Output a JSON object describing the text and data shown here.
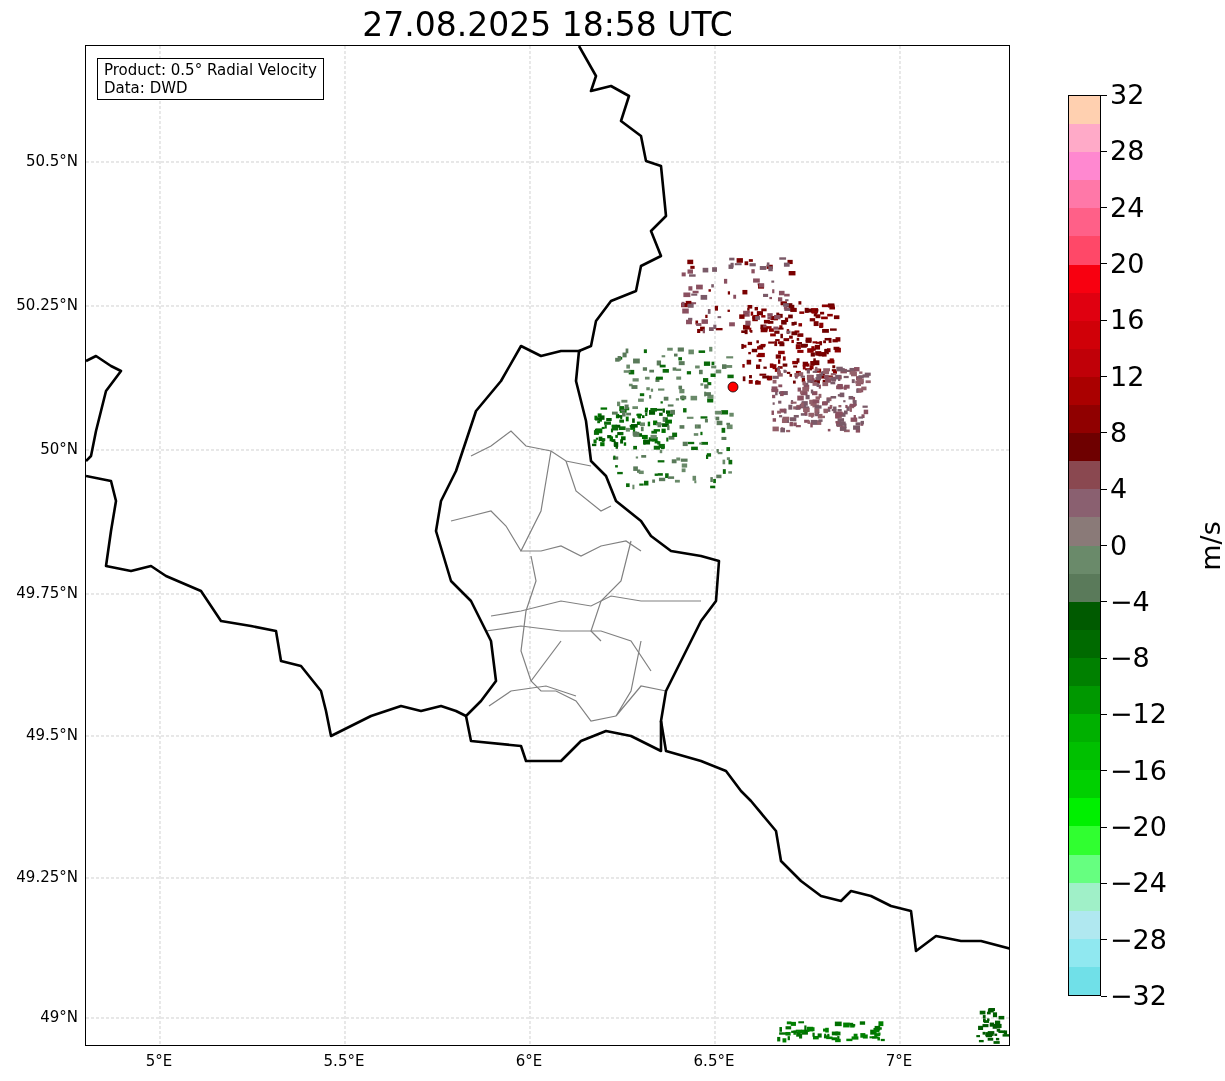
{
  "title": "27.08.2025 18:58 UTC",
  "info_box": {
    "lines": [
      "Product: 0.5° Radial Velocity",
      "Data: DWD"
    ]
  },
  "map": {
    "x_ticks": [
      "5°E",
      "5.5°E",
      "6°E",
      "6.5°E",
      "7°E"
    ],
    "y_ticks": [
      "50.5°N",
      "50.25°N",
      "50°N",
      "49.75°N",
      "49.5°N",
      "49.25°N",
      "49°N"
    ]
  },
  "colorbar": {
    "label": "m/s",
    "ticks": [
      "32",
      "28",
      "24",
      "20",
      "16",
      "12",
      "8",
      "4",
      "0",
      "−4",
      "−8",
      "−12",
      "−16",
      "−20",
      "−24",
      "−28",
      "−32"
    ],
    "segments": [
      {
        "color": "#ffd0b0"
      },
      {
        "color": "#ffaac8"
      },
      {
        "color": "#ff88d0"
      },
      {
        "color": "#ff78a8"
      },
      {
        "color": "#ff6088"
      },
      {
        "color": "#ff4868"
      },
      {
        "color": "#f80010"
      },
      {
        "color": "#e00010"
      },
      {
        "color": "#d00008"
      },
      {
        "color": "#c00008"
      },
      {
        "color": "#aa0000"
      },
      {
        "color": "#900000"
      },
      {
        "color": "#6e0000"
      },
      {
        "color": "#8a4850"
      },
      {
        "color": "#8a6070"
      },
      {
        "color": "#8a7a78"
      },
      {
        "color": "#6a8a6a"
      },
      {
        "color": "#5a7a5a"
      },
      {
        "color": "#005a00"
      },
      {
        "color": "#006a00"
      },
      {
        "color": "#008000"
      },
      {
        "color": "#009800"
      },
      {
        "color": "#00b000"
      },
      {
        "color": "#00c000"
      },
      {
        "color": "#00d000"
      },
      {
        "color": "#00f000"
      },
      {
        "color": "#30ff30"
      },
      {
        "color": "#66ff80"
      },
      {
        "color": "#a0f0c8"
      },
      {
        "color": "#b0e8f0"
      },
      {
        "color": "#90e8f0"
      },
      {
        "color": "#70e0e8"
      }
    ]
  }
}
